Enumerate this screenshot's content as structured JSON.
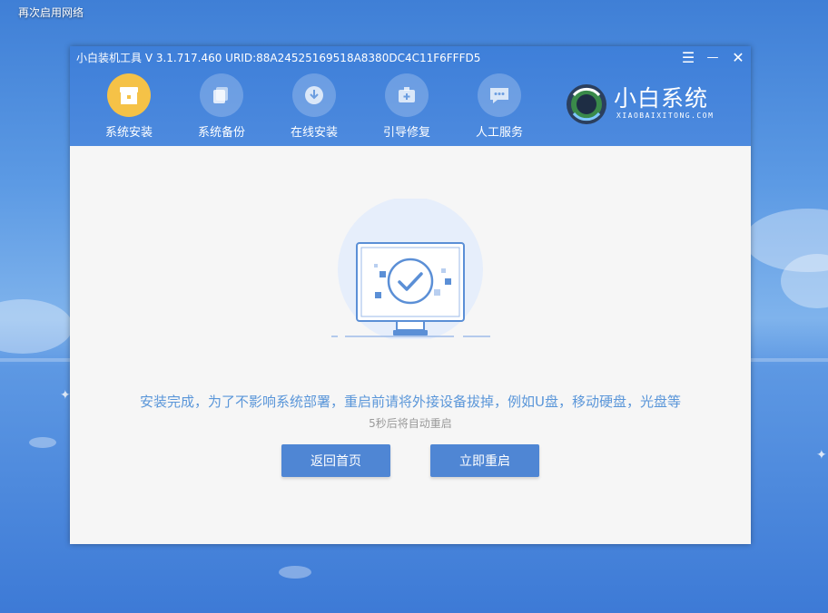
{
  "desktop": {
    "shortcut_label": "再次启用网络",
    "edge_chars": [
      "’",
      "​",
      "​",
      "​",
      "​",
      "​"
    ]
  },
  "window": {
    "title": "小白装机工具 V 3.1.717.460 URID:88A24525169518A8380DC4C11F6FFFD5",
    "controls": {
      "menu": "☰",
      "minimize": "—",
      "close": "✕"
    },
    "nav": [
      {
        "label": "系统安装",
        "icon": "install-box-icon",
        "active": true
      },
      {
        "label": "系统备份",
        "icon": "backup-icon",
        "active": false
      },
      {
        "label": "在线安装",
        "icon": "online-install-icon",
        "active": false
      },
      {
        "label": "引导修复",
        "icon": "boot-repair-icon",
        "active": false
      },
      {
        "label": "人工服务",
        "icon": "chat-service-icon",
        "active": false
      }
    ],
    "brand": {
      "name": "小白系统",
      "url": "XIAOBAIXITONG.COM"
    }
  },
  "content": {
    "message": "安装完成，为了不影响系统部署，重启前请将外接设备拔掉，例如U盘，移动硬盘，光盘等",
    "countdown": "5秒后将自动重启",
    "buttons": {
      "home": "返回首页",
      "restart": "立即重启"
    }
  },
  "colors": {
    "accent": "#4f86d4",
    "titlebar": "#4d8ade",
    "active_nav": "#f5c247",
    "message_text": "#5a96d9"
  }
}
